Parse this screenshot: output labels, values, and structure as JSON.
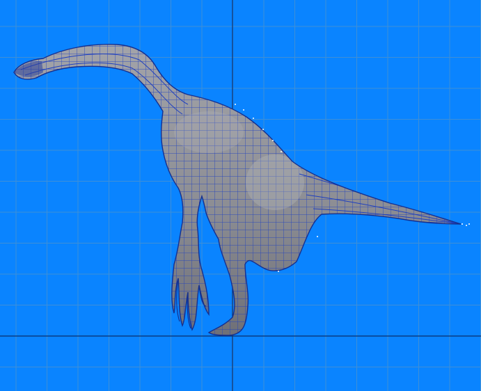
{
  "viewport": {
    "background": "#0a84ff",
    "grid_color": "#3f8fd6",
    "axis_color": "#0b2f6a",
    "model": {
      "subject": "theropod-dinosaur-wireframe-mesh",
      "skin_color": "#8e8f95",
      "wire_color": "#1e3fbf"
    }
  }
}
